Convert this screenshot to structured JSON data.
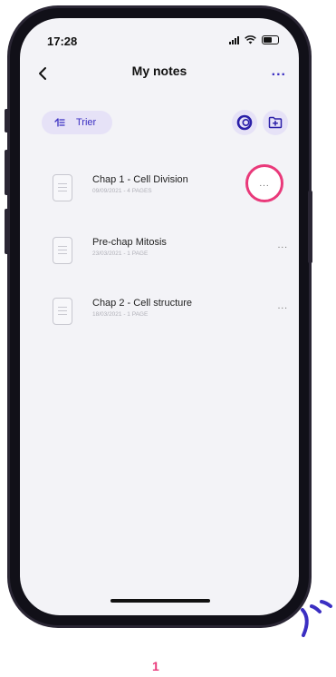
{
  "status_bar": {
    "time": "17:28"
  },
  "nav": {
    "title": "My notes",
    "more_label": "..."
  },
  "toolbar": {
    "sort_label": "Trier"
  },
  "notes": [
    {
      "title": "Chap 1 - Cell Division",
      "meta": "09/09/2021 - 4 PAGES",
      "more": "..."
    },
    {
      "title": "Pre-chap Mitosis",
      "meta": "23/03/2021 - 1 PAGE",
      "more": "..."
    },
    {
      "title": "Chap 2 - Cell structure",
      "meta": "18/03/2021 - 1 PAGE",
      "more": "..."
    }
  ],
  "annotation": {
    "step_number": "1"
  },
  "colors": {
    "accent": "#3b2fc2",
    "highlight": "#e9397a",
    "pill_bg": "#e6e2f7"
  },
  "icons": [
    "back-arrow-icon",
    "more-icon",
    "sort-icon",
    "ring-icon",
    "add-folder-icon",
    "document-icon"
  ]
}
